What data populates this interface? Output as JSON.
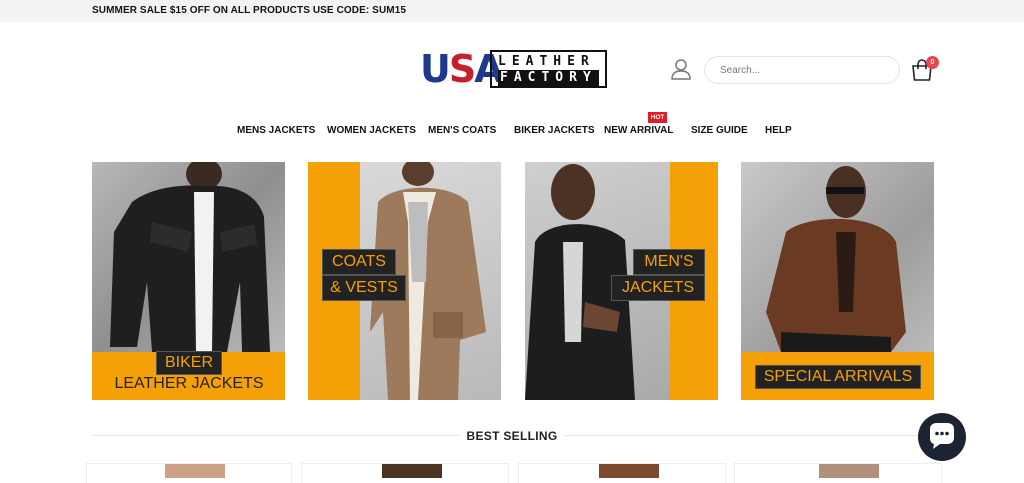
{
  "announcement": "SUMMER SALE $15 OFF ON ALL PRODUCTS USE CODE: SUM15",
  "logo": {
    "part1": "USA",
    "line1": "LEATHER",
    "line2": "FACTORY"
  },
  "header": {
    "search_placeholder": "Search...",
    "cart_count": "0",
    "user_icon": "user-icon",
    "cart_icon": "shopping-bag-icon"
  },
  "nav": {
    "items": [
      {
        "label": "MENS JACKETS"
      },
      {
        "label": "WOMEN JACKETS"
      },
      {
        "label": "MEN'S COATS"
      },
      {
        "label": "BIKER JACKETS"
      },
      {
        "label": "NEW ARRIVAL"
      },
      {
        "label": "SIZE GUIDE"
      },
      {
        "label": "HELP"
      }
    ],
    "hot_badge": "HOT"
  },
  "banners": [
    {
      "lines": [
        "BIKER",
        "LEATHER JACKETS"
      ]
    },
    {
      "lines": [
        "COATS",
        "& VESTS"
      ]
    },
    {
      "lines": [
        "MEN'S",
        "JACKETS"
      ]
    },
    {
      "lines": [
        "SPECIAL ARRIVALS"
      ]
    }
  ],
  "section": {
    "title": "BEST SELLING"
  },
  "chat": {
    "icon": "chat-bubble-icon"
  },
  "colors": {
    "accent": "#f5a006",
    "hot": "#e21b23",
    "cart_badge": "#e8464b",
    "chat_button": "#1c2332"
  }
}
